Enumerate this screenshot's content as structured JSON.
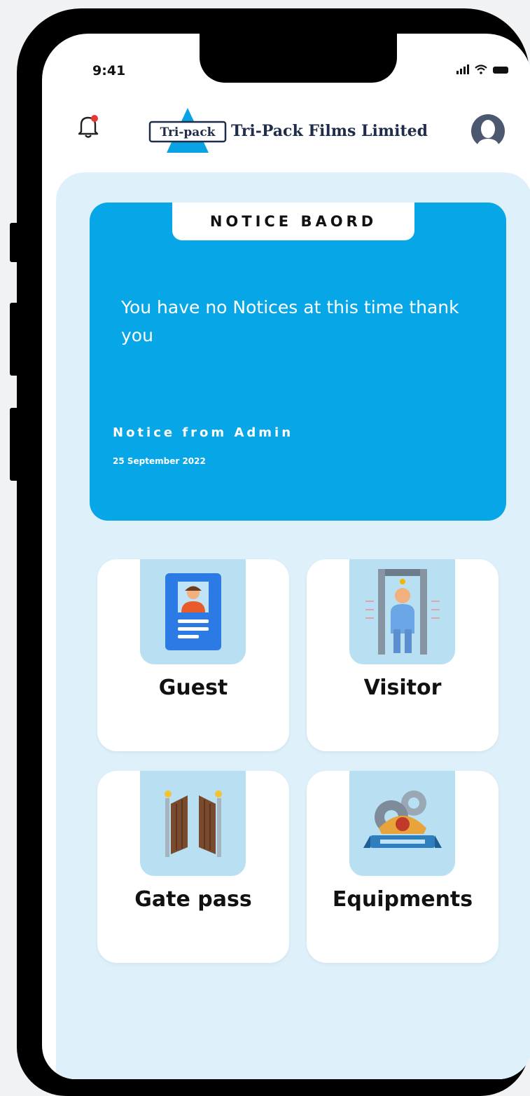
{
  "status_bar": {
    "time": "9:41"
  },
  "header": {
    "logo_text": "Tri-pack",
    "company_name": "Tri-Pack Films Limited"
  },
  "notice_board": {
    "title": "NOTICE BAORD",
    "message": "You have no Notices at this time thank you",
    "from": "Notice from Admin",
    "date": "25 September 2022"
  },
  "tiles": [
    {
      "label": "Guest",
      "icon": "id-card-icon"
    },
    {
      "label": "Visitor",
      "icon": "security-scanner-icon"
    },
    {
      "label": "Gate pass",
      "icon": "gate-icon"
    },
    {
      "label": "Equipments",
      "icon": "equipment-gears-icon"
    }
  ],
  "colors": {
    "accent": "#07a6e7",
    "panel_bg": "#def1fb",
    "tile_art_bg": "#b9dff2"
  }
}
